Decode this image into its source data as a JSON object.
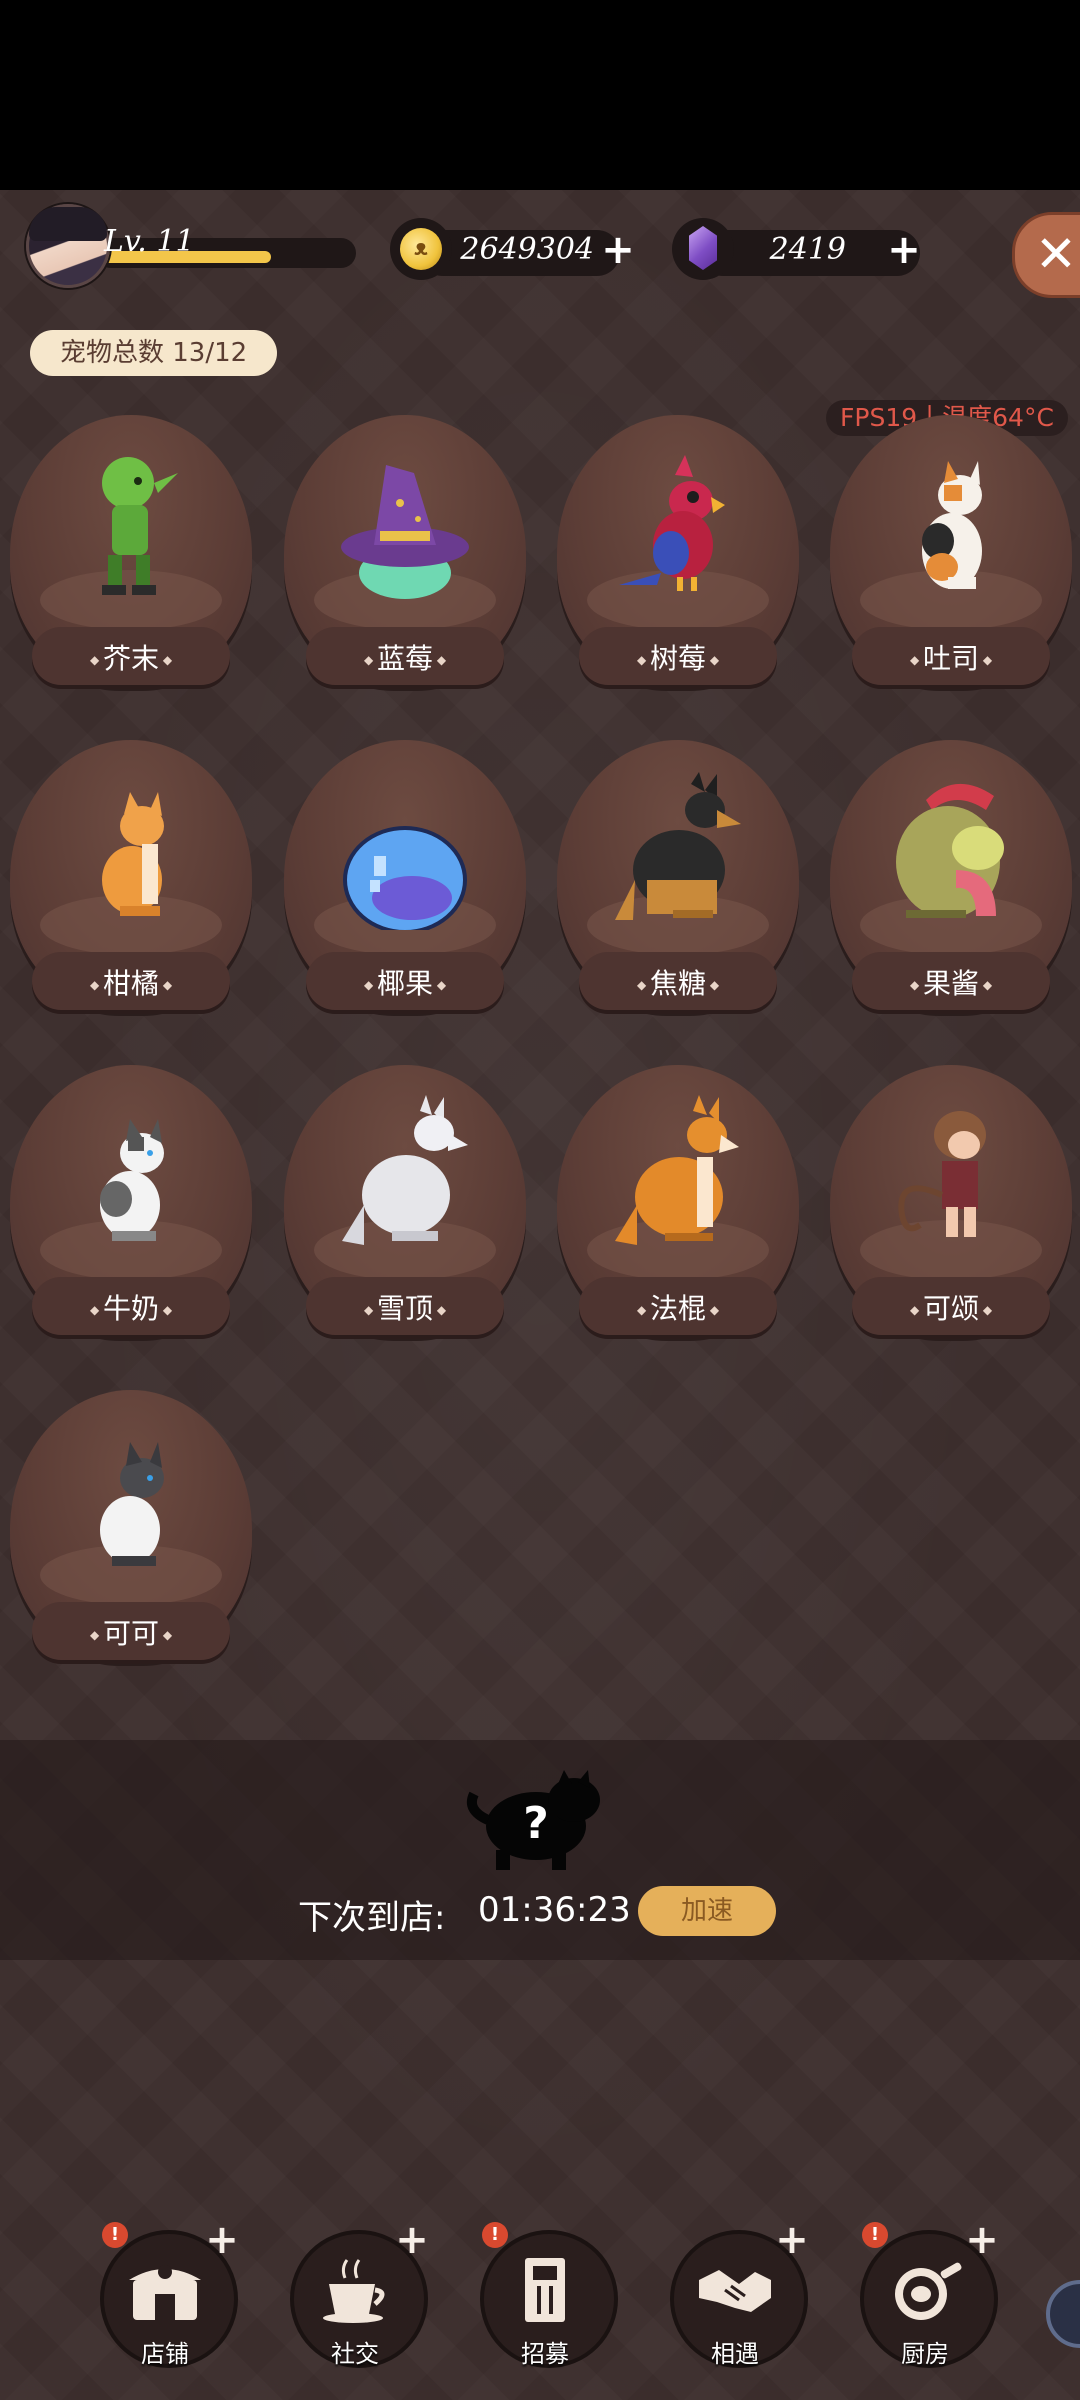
{
  "player": {
    "level": "Lv. 11",
    "level_progress": 0.7
  },
  "currency": {
    "coins": "2649304",
    "gems": "2419",
    "coin_icon": "cat-coin-icon",
    "gem_icon": "purple-gem-icon"
  },
  "pet_count": "宠物总数 13/12",
  "fps_text": "FPS19丨温度64°C",
  "pets": [
    {
      "name": "芥末",
      "sprite": "green-goblin"
    },
    {
      "name": "蓝莓",
      "sprite": "purple-witch-hat-slime"
    },
    {
      "name": "树莓",
      "sprite": "red-parrot"
    },
    {
      "name": "吐司",
      "sprite": "calico-cat"
    },
    {
      "name": "柑橘",
      "sprite": "orange-cat"
    },
    {
      "name": "椰果",
      "sprite": "blue-slime"
    },
    {
      "name": "焦糖",
      "sprite": "german-shepherd"
    },
    {
      "name": "果酱",
      "sprite": "helmet-creature"
    },
    {
      "name": "牛奶",
      "sprite": "white-gray-cat"
    },
    {
      "name": "雪顶",
      "sprite": "white-wolf"
    },
    {
      "name": "法棍",
      "sprite": "shiba-dog"
    },
    {
      "name": "可颂",
      "sprite": "monkey-kid"
    },
    {
      "name": "可可",
      "sprite": "siamese-cat"
    }
  ],
  "arrival": {
    "label": "下次到店:",
    "timer": "01:36:23",
    "speed_up": "加速",
    "mystery": "?"
  },
  "nav": [
    {
      "label": "店铺",
      "icon": "shop-icon",
      "alert": "!",
      "plus": "+"
    },
    {
      "label": "社交",
      "icon": "coffee-cup-icon",
      "plus": "+"
    },
    {
      "label": "招募",
      "icon": "door-icon",
      "alert": "!"
    },
    {
      "label": "相遇",
      "icon": "handshake-icon",
      "plus": "+"
    },
    {
      "label": "厨房",
      "icon": "frying-pan-icon",
      "alert": "!",
      "plus": "+"
    }
  ],
  "colors": {
    "background": "#3b2d2c",
    "accent_gold": "#f3c64a",
    "speed_button": "#e5b05a",
    "close_button": "#b46a4c",
    "fps_text": "#e0584a"
  }
}
